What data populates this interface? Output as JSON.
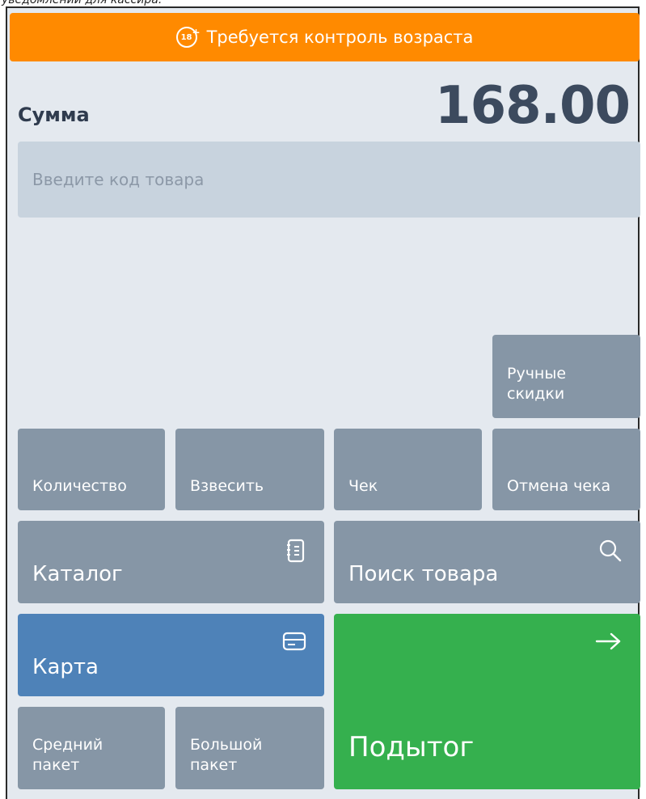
{
  "caption": "уведомлений для кассира.",
  "age_banner": {
    "badge": "18",
    "text": "Требуется контроль возраста"
  },
  "sum": {
    "label": "Сумма",
    "value": "168.00"
  },
  "search": {
    "placeholder": "Введите код товара"
  },
  "buttons": {
    "manual_discounts": "Ручные скидки",
    "quantity": "Количество",
    "weigh": "Взвесить",
    "receipt": "Чек",
    "cancel_receipt": "Отмена чека",
    "catalog": "Каталог",
    "product_search": "Поиск товара",
    "card": "Карта",
    "medium_bag": "Средний пакет",
    "large_bag": "Большой пакет",
    "subtotal": "Подытог"
  },
  "colors": {
    "banner": "#ff8a00",
    "button": "#8696a6",
    "card": "#4e82b8",
    "subtotal": "#35b04e",
    "background": "#e4e9ef"
  }
}
